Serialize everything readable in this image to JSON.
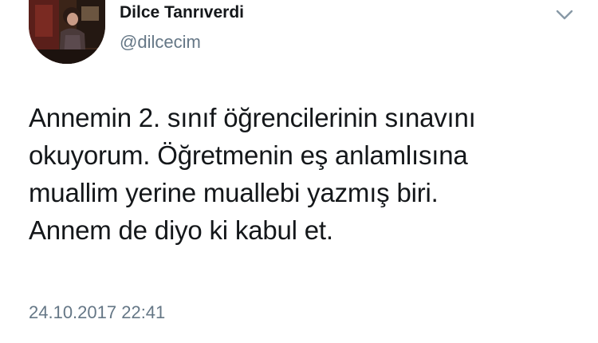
{
  "author": {
    "display_name": "Dilce Tanrıverdi",
    "handle": "@dilcecim"
  },
  "tweet": {
    "text_lines": [
      "Annemin 2. sınıf öğrencilerinin sınavını",
      "okuyorum. Öğretmenin eş anlamlısına",
      "muallim yerine muallebi yazmış biri.",
      "Annem de diyo ki kabul et."
    ],
    "timestamp": "24.10.2017 22:41"
  },
  "icons": {
    "avatar": "profile-photo",
    "menu": "chevron-down-icon"
  },
  "colors": {
    "name": "#14171a",
    "secondary_text": "#657786",
    "background": "#ffffff"
  }
}
